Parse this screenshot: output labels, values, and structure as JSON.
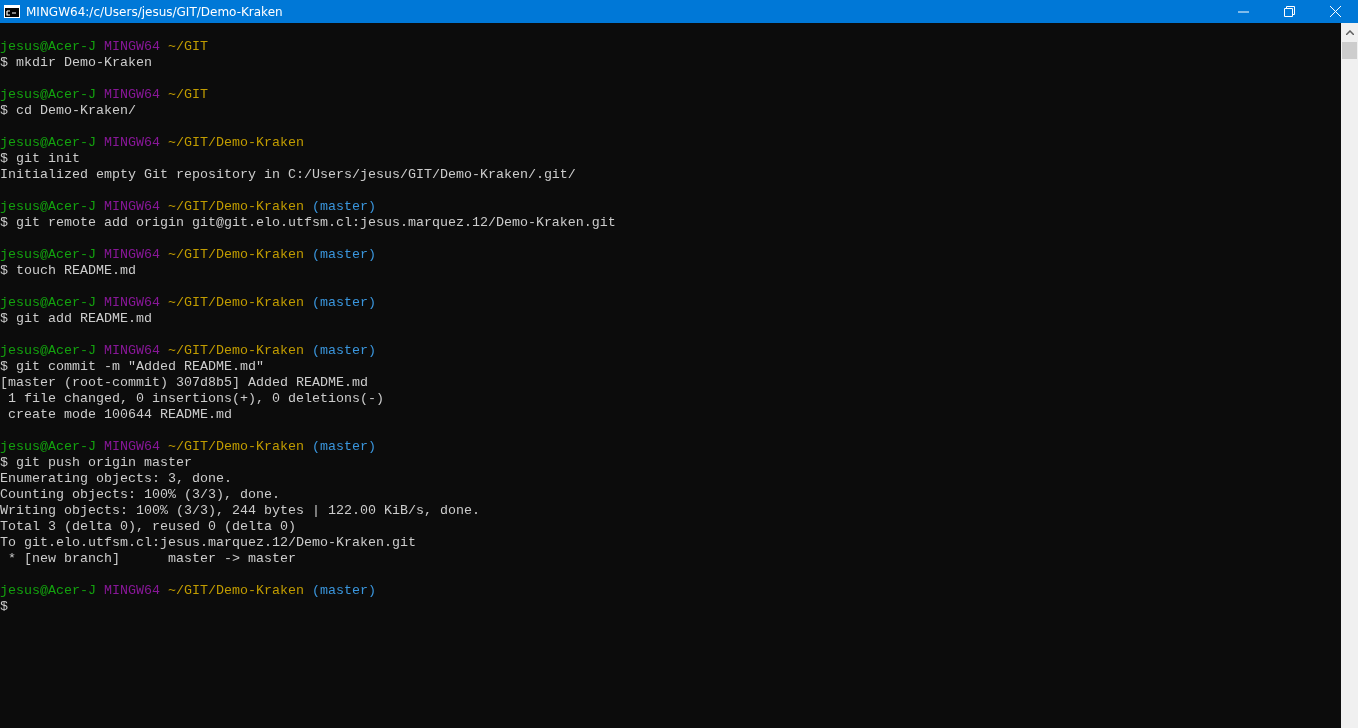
{
  "window": {
    "title": "MINGW64:/c/Users/jesus/GIT/Demo-Kraken"
  },
  "lines": [
    {
      "kind": "prompt",
      "user_host": "jesus@Acer-J",
      "system": "MINGW64",
      "path": "~/GIT"
    },
    {
      "kind": "command",
      "text": "$ mkdir Demo-Kraken"
    },
    {
      "kind": "blank"
    },
    {
      "kind": "prompt",
      "user_host": "jesus@Acer-J",
      "system": "MINGW64",
      "path": "~/GIT"
    },
    {
      "kind": "command",
      "text": "$ cd Demo-Kraken/"
    },
    {
      "kind": "blank"
    },
    {
      "kind": "prompt",
      "user_host": "jesus@Acer-J",
      "system": "MINGW64",
      "path": "~/GIT/Demo-Kraken"
    },
    {
      "kind": "command",
      "text": "$ git init"
    },
    {
      "kind": "output",
      "text": "Initialized empty Git repository in C:/Users/jesus/GIT/Demo-Kraken/.git/"
    },
    {
      "kind": "blank"
    },
    {
      "kind": "prompt",
      "user_host": "jesus@Acer-J",
      "system": "MINGW64",
      "path": "~/GIT/Demo-Kraken",
      "branch": "(master)"
    },
    {
      "kind": "command",
      "text": "$ git remote add origin git@git.elo.utfsm.cl:jesus.marquez.12/Demo-Kraken.git"
    },
    {
      "kind": "blank"
    },
    {
      "kind": "prompt",
      "user_host": "jesus@Acer-J",
      "system": "MINGW64",
      "path": "~/GIT/Demo-Kraken",
      "branch": "(master)"
    },
    {
      "kind": "command",
      "text": "$ touch README.md"
    },
    {
      "kind": "blank"
    },
    {
      "kind": "prompt",
      "user_host": "jesus@Acer-J",
      "system": "MINGW64",
      "path": "~/GIT/Demo-Kraken",
      "branch": "(master)"
    },
    {
      "kind": "command",
      "text": "$ git add README.md"
    },
    {
      "kind": "blank"
    },
    {
      "kind": "prompt",
      "user_host": "jesus@Acer-J",
      "system": "MINGW64",
      "path": "~/GIT/Demo-Kraken",
      "branch": "(master)"
    },
    {
      "kind": "command",
      "text": "$ git commit -m \"Added README.md\""
    },
    {
      "kind": "output",
      "text": "[master (root-commit) 307d8b5] Added README.md"
    },
    {
      "kind": "output",
      "text": " 1 file changed, 0 insertions(+), 0 deletions(-)"
    },
    {
      "kind": "output",
      "text": " create mode 100644 README.md"
    },
    {
      "kind": "blank"
    },
    {
      "kind": "prompt",
      "user_host": "jesus@Acer-J",
      "system": "MINGW64",
      "path": "~/GIT/Demo-Kraken",
      "branch": "(master)"
    },
    {
      "kind": "command",
      "text": "$ git push origin master"
    },
    {
      "kind": "output",
      "text": "Enumerating objects: 3, done."
    },
    {
      "kind": "output",
      "text": "Counting objects: 100% (3/3), done."
    },
    {
      "kind": "output",
      "text": "Writing objects: 100% (3/3), 244 bytes | 122.00 KiB/s, done."
    },
    {
      "kind": "output",
      "text": "Total 3 (delta 0), reused 0 (delta 0)"
    },
    {
      "kind": "output",
      "text": "To git.elo.utfsm.cl:jesus.marquez.12/Demo-Kraken.git"
    },
    {
      "kind": "output",
      "text": " * [new branch]      master -> master"
    },
    {
      "kind": "blank"
    },
    {
      "kind": "prompt",
      "user_host": "jesus@Acer-J",
      "system": "MINGW64",
      "path": "~/GIT/Demo-Kraken",
      "branch": "(master)"
    },
    {
      "kind": "command",
      "text": "$"
    }
  ]
}
